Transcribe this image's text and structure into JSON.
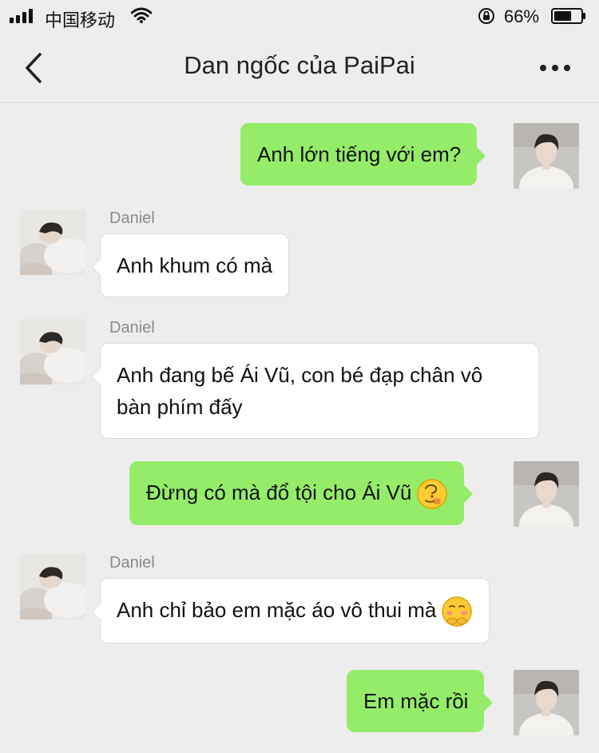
{
  "status_bar": {
    "carrier": "中国移动",
    "battery_percent": "66%",
    "battery_level": 0.66
  },
  "nav": {
    "title": "Dan ngốc của PaiPai"
  },
  "messages": [
    {
      "side": "right",
      "text": "Anh lớn tiếng với em?"
    },
    {
      "side": "left",
      "sender": "Daniel",
      "text": "Anh khum có mà"
    },
    {
      "side": "left",
      "sender": "Daniel",
      "text": "Anh đang bế Ái Vũ, con bé đạp chân vô bàn phím đấy"
    },
    {
      "side": "right",
      "text": "Đừng có mà đổ tội cho Ái Vũ",
      "emoji": "thinking-emoji"
    },
    {
      "side": "left",
      "sender": "Daniel",
      "text": "Anh chỉ bảo em mặc áo vô thui mà",
      "emoji": "shy-emoji"
    },
    {
      "side": "right",
      "text": "Em mặc rồi"
    }
  ],
  "colors": {
    "background": "#ededed",
    "sent_bubble": "#95ec69",
    "received_bubble": "#ffffff"
  }
}
